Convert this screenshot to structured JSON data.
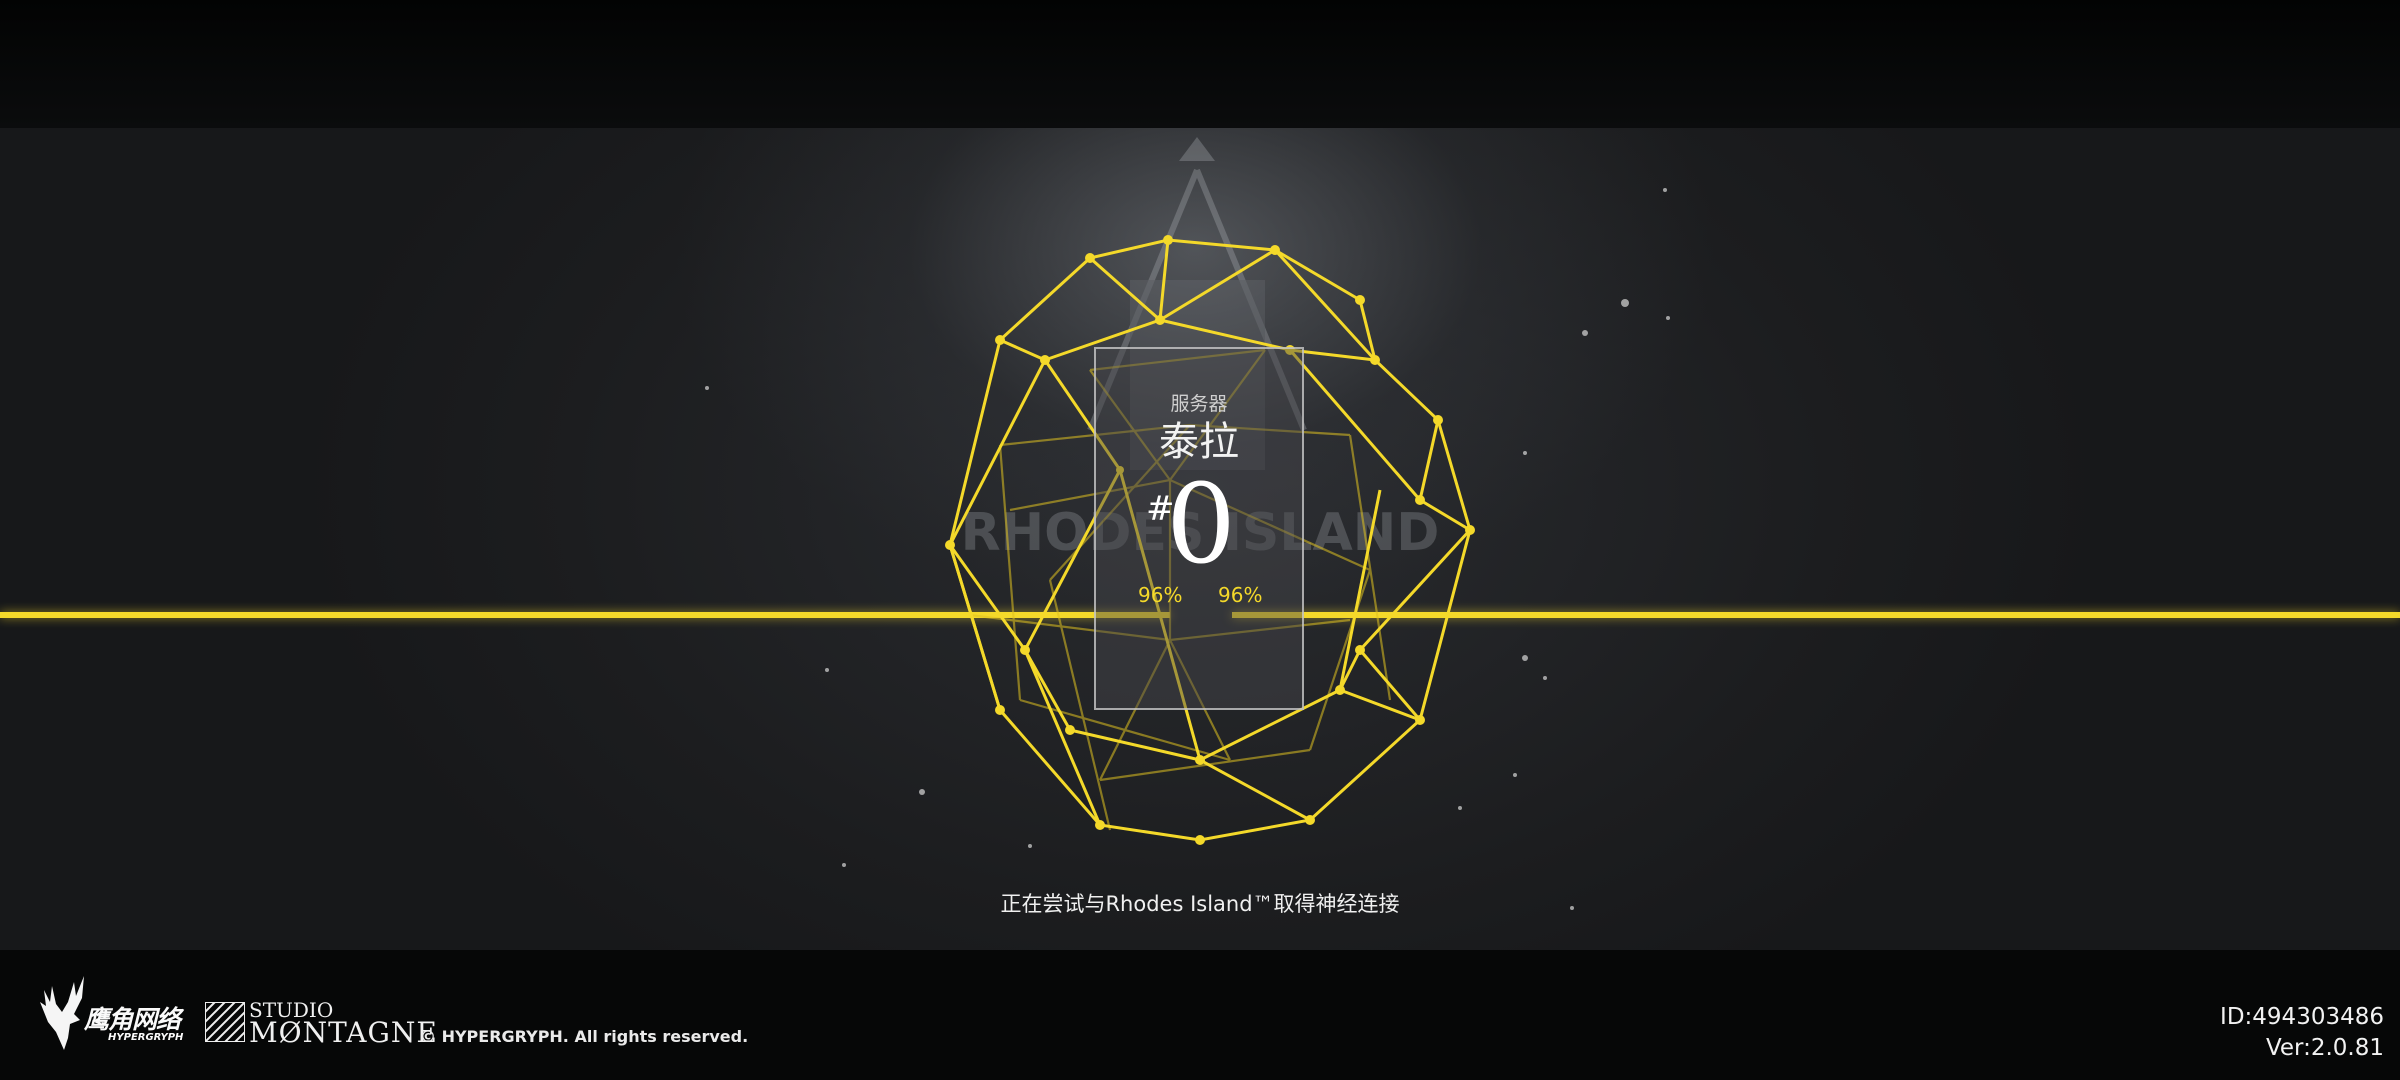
{
  "server": {
    "label": "服务器",
    "name": "泰拉",
    "hash": "#",
    "number": "0",
    "percent_left": "96%",
    "percent_right": "96%"
  },
  "loading": {
    "progress": 0.96,
    "status_text": "正在尝试与Rhodes Island™取得神经连接"
  },
  "footer": {
    "publisher_cn": "鹰角网络",
    "publisher_en": "HYPERGRYPH",
    "studio_line1": "STUDIO",
    "studio_line2": "MØNTAGNE",
    "copyright": "© HYPERGRYPH. All rights reserved.",
    "user_id": "ID:494303486",
    "version": "Ver:2.0.81"
  },
  "background_logo_text": "RHODES ISLAND",
  "colors": {
    "accent": "#f4d92a",
    "background": "#1c1d1f",
    "text": "#f0f0f0"
  }
}
